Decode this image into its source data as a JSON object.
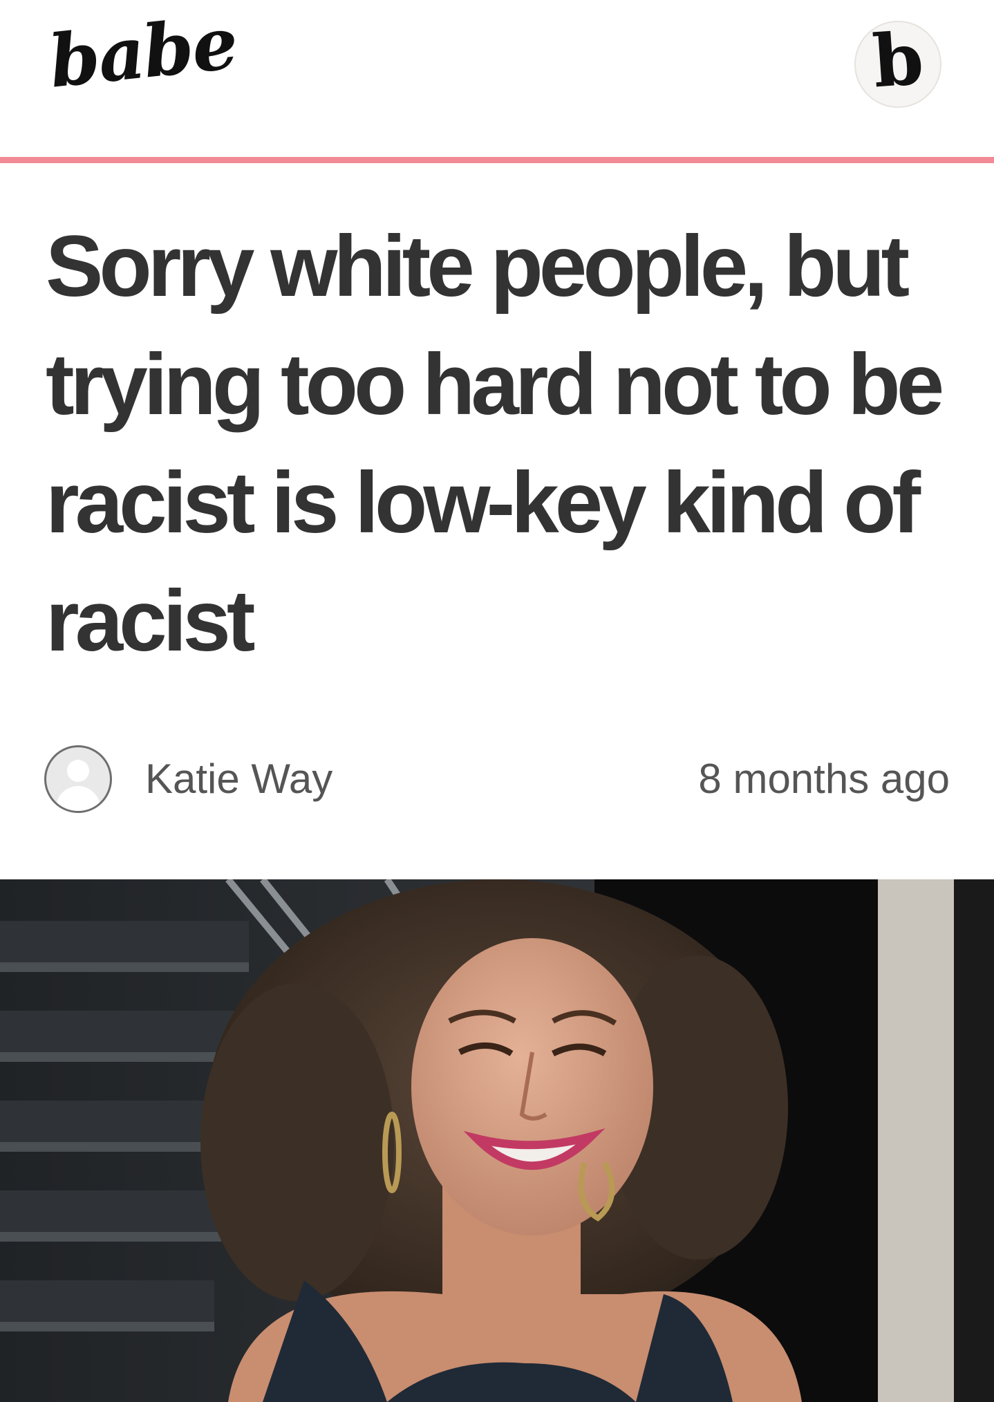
{
  "header": {
    "logo_text": "babe",
    "badge_letter": "b",
    "accent_color": "#f18a94"
  },
  "article": {
    "title": "Sorry white people, but trying too hard not to be racist is low-key kind of racist",
    "author": "Katie Way",
    "published": "8 months ago",
    "author_avatar_icon": "default-user-avatar-icon",
    "hero_image": "photo of a smiling woman with curly hair and hoop earrings in a dark tank top"
  }
}
